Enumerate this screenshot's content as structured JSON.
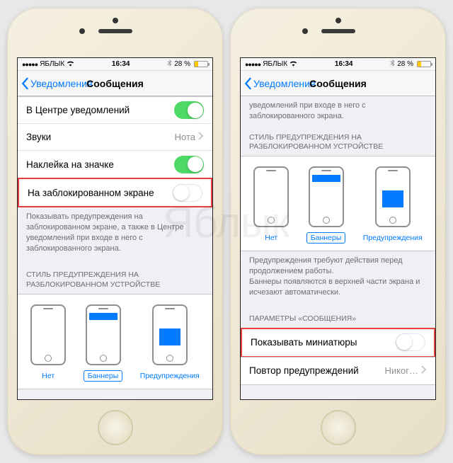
{
  "statusbar": {
    "carrier": "ЯБЛЫК",
    "time": "16:34",
    "battery_pct": "28 %"
  },
  "nav": {
    "back": "Уведомления",
    "title": "Сообщения"
  },
  "left": {
    "rows": {
      "notification_center": "В Центре уведомлений",
      "sounds": "Звуки",
      "sounds_value": "Нота",
      "badge": "Наклейка на значке",
      "lock_screen": "На заблокированном экране"
    },
    "footer1": "Показывать предупреждения на заблокированном экране, а также в Центре уведомлений при входе в него с заблокированного экрана.",
    "header_style": "СТИЛЬ ПРЕДУПРЕЖДЕНИЯ НА РАЗБЛОКИРОВАННОМ УСТРОЙСТВЕ",
    "styles": {
      "none": "Нет",
      "banners": "Баннеры",
      "alerts": "Предупреждения"
    }
  },
  "right": {
    "top_footer": "уведомлений при входе в него с заблокированного экрана.",
    "header_style": "СТИЛЬ ПРЕДУПРЕЖДЕНИЯ НА РАЗБЛОКИРОВАННОМ УСТРОЙСТВЕ",
    "styles": {
      "none": "Нет",
      "banners": "Баннеры",
      "alerts": "Предупреждения"
    },
    "footer_style": "Предупреждения требуют действия перед продолжением работы.\nБаннеры появляются в верхней части экрана и исчезают автоматически.",
    "header_params": "ПАРАМЕТРЫ «СООБЩЕНИЯ»",
    "show_previews": "Показывать миниатюры",
    "repeat": "Повтор предупреждений",
    "repeat_value": "Никог…"
  }
}
